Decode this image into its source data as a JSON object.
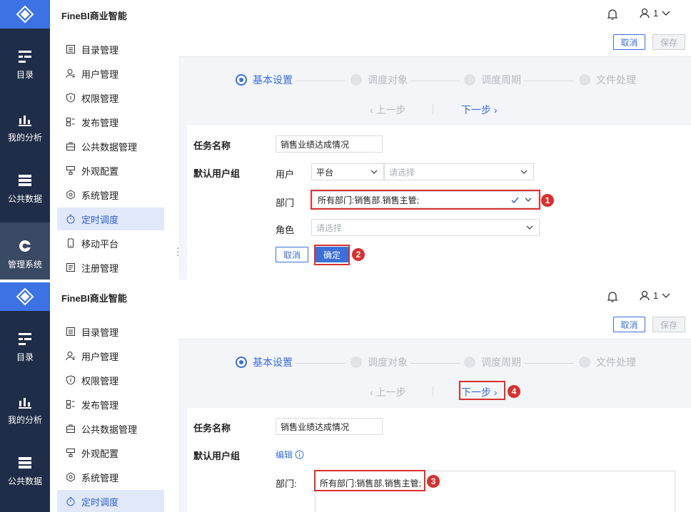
{
  "app": {
    "title": "FineBI商业智能",
    "user": "1"
  },
  "rail": [
    {
      "label": "目录",
      "icon": "catalog-icon"
    },
    {
      "label": "我的分析",
      "icon": "analysis-icon"
    },
    {
      "label": "公共数据",
      "icon": "public-data-icon"
    },
    {
      "label": "管理系统",
      "icon": "admin-gear-icon"
    }
  ],
  "sidebar": [
    {
      "label": "目录管理",
      "icon": "directory-icon"
    },
    {
      "label": "用户管理",
      "icon": "user-icon"
    },
    {
      "label": "权限管理",
      "icon": "shield-icon"
    },
    {
      "label": "发布管理",
      "icon": "publish-icon"
    },
    {
      "label": "公共数据管理",
      "icon": "briefcase-icon"
    },
    {
      "label": "外观配置",
      "icon": "appearance-icon"
    },
    {
      "label": "系统管理",
      "icon": "settings-icon"
    },
    {
      "label": "定时调度",
      "icon": "timer-icon"
    },
    {
      "label": "移动平台",
      "icon": "mobile-icon"
    },
    {
      "label": "注册管理",
      "icon": "register-icon"
    }
  ],
  "actions": {
    "cancel": "取消",
    "save": "保存"
  },
  "steps": [
    "基本设置",
    "调度对象",
    "调度周期",
    "文件处理"
  ],
  "nav": {
    "prev": "上一步",
    "next": "下一步"
  },
  "form": {
    "task_name_label": "任务名称",
    "task_name_value": "销售业绩达成情况",
    "default_group_label": "默认用户组",
    "user_label": "用户",
    "user_type_value": "平台",
    "user_select_placeholder": "请选择",
    "dept_label": "部门",
    "dept_value": "所有部门:销售部.销售主管;",
    "role_label": "角色",
    "role_placeholder": "请选择",
    "cancel_btn": "取消",
    "confirm_btn": "确定",
    "edit_link": "编辑",
    "dept_label_colon": "部门:",
    "dept_summary": "所有部门:销售部.销售主管;"
  },
  "badges": [
    "1",
    "2",
    "3",
    "4"
  ]
}
